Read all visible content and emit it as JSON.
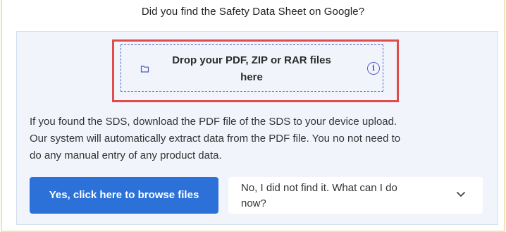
{
  "question": "Did you find the Safety Data Sheet on Google?",
  "dropzone": {
    "text_line1": "Drop your PDF, ZIP or RAR files",
    "text_line2": "here",
    "file_icon": "folder-file-icon",
    "info_icon": "info-icon",
    "info_glyph": "i"
  },
  "description": {
    "line1": "If you found the SDS, download the PDF file of the SDS to your device upload.",
    "line2": "Our system will automatically extract data from the PDF file. You no not need to",
    "line3": "do any manual entry of any product data."
  },
  "buttons": {
    "browse_label": "Yes, click here to browse files",
    "not_found_line1": "No, I did not find it. What can I do",
    "not_found_line2": "now?",
    "chevron_icon": "chevron-down-icon"
  },
  "colors": {
    "accent": "#2b71d8",
    "dropzone_border": "#5561c8",
    "highlight": "#e04b4b",
    "panel_bg": "#f1f5fb"
  }
}
